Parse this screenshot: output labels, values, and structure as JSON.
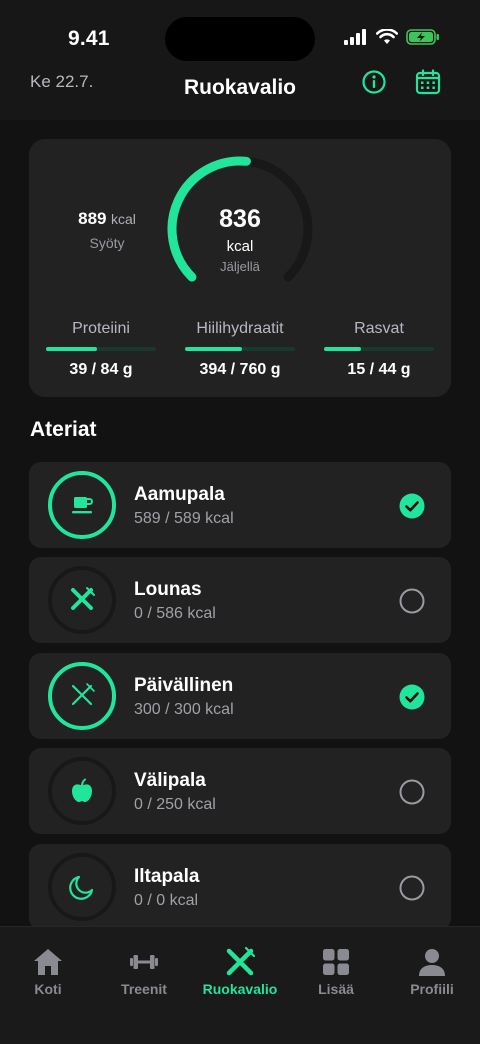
{
  "status": {
    "time": "9.41"
  },
  "header": {
    "date": "Ke 22.7.",
    "title": "Ruokavalio"
  },
  "summary": {
    "eaten_value": "889",
    "eaten_unit": "kcal",
    "eaten_label": "Syöty",
    "remaining_value": "836",
    "remaining_unit": "kcal",
    "remaining_label": "Jäljellä",
    "ring_fraction": 0.52
  },
  "macros": [
    {
      "name": "Proteiini",
      "value": "39 / 84 g",
      "fraction": 0.46
    },
    {
      "name": "Hiilihydraatit",
      "value": "394 / 760 g",
      "fraction": 0.52
    },
    {
      "name": "Rasvat",
      "value": "15 / 44 g",
      "fraction": 0.34
    }
  ],
  "section_title": "Ateriat",
  "meals": [
    {
      "name": "Aamupala",
      "kcal": "589 / 589 kcal",
      "done": true,
      "icon": "coffee-cup-icon"
    },
    {
      "name": "Lounas",
      "kcal": "0 / 586 kcal",
      "done": false,
      "icon": "fork-knife-icon"
    },
    {
      "name": "Päivällinen",
      "kcal": "300 / 300 kcal",
      "done": true,
      "icon": "fork-knife-icon"
    },
    {
      "name": "Välipala",
      "kcal": "0 / 250 kcal",
      "done": false,
      "icon": "apple-icon"
    },
    {
      "name": "Iltapala",
      "kcal": "0 / 0 kcal",
      "done": false,
      "icon": "moon-icon"
    }
  ],
  "tabs": [
    {
      "label": "Koti",
      "icon": "home-icon",
      "active": false
    },
    {
      "label": "Treenit",
      "icon": "dumbbell-icon",
      "active": false
    },
    {
      "label": "Ruokavalio",
      "icon": "fork-knife-icon",
      "active": true
    },
    {
      "label": "Lisää",
      "icon": "grid-icon",
      "active": false
    },
    {
      "label": "Profiili",
      "icon": "person-icon",
      "active": false
    }
  ],
  "colors": {
    "accent": "#20e59a",
    "background": "#121212",
    "card": "#222222",
    "muted": "#8a8a92"
  }
}
